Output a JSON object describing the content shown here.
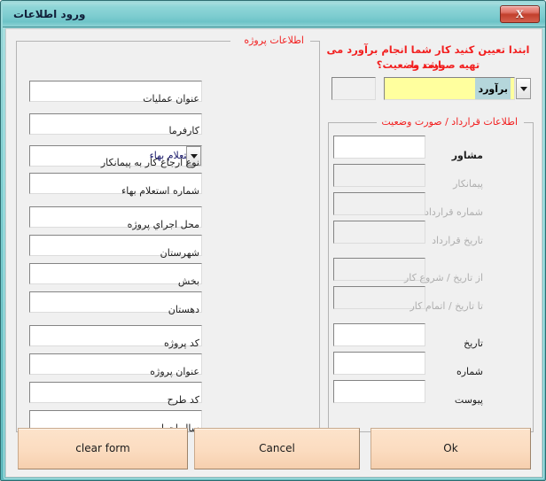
{
  "window": {
    "title": "ورود اطلاعات",
    "close_label": "X",
    "accent_titlebar": "#7ecdd0",
    "accent_border": "#2f6e72",
    "client_bg": "#f0f0f0"
  },
  "left_panel": {
    "legend": "اطلاعات پروژه",
    "legend_color": "#f22020",
    "rows": [
      {
        "label": "عنوان عملیات",
        "value": "",
        "type": "text",
        "enabled": true
      },
      {
        "label": "کارفرما",
        "value": "",
        "type": "text",
        "enabled": true
      },
      {
        "label": "نوع ارجاع کار به پیمانکار",
        "value": "استعلام بهاء",
        "type": "combo",
        "enabled": true
      },
      {
        "label": "شماره استعلام بهاء",
        "value": "",
        "type": "text",
        "enabled": true
      },
      {
        "label": "محل اجراي پروژه",
        "value": "",
        "type": "text",
        "enabled": true
      },
      {
        "label": "شهرستان",
        "value": "",
        "type": "text",
        "enabled": true
      },
      {
        "label": "بخش",
        "value": "",
        "type": "text",
        "enabled": true
      },
      {
        "label": "دهستان",
        "value": "",
        "type": "text",
        "enabled": true
      },
      {
        "label": "کد پروژه",
        "value": "",
        "type": "text",
        "enabled": true
      },
      {
        "label": "عنوان پروژه",
        "value": "",
        "type": "text",
        "enabled": true
      },
      {
        "label": "کد طرح",
        "value": "",
        "type": "text",
        "enabled": true
      },
      {
        "label": "سال اجرا",
        "value": "",
        "type": "text",
        "enabled": true
      }
    ]
  },
  "right_panel": {
    "prompt_line1": "ابتدا تعیین کنید کار شما انجام برآورد می باشد یا",
    "prompt_line2": "تهیه صورت وضعیت؟",
    "prompt_color": "#f22020",
    "mode_code_value": "",
    "mode_select": {
      "value": "برآورد",
      "selected_highlight": true,
      "bg": "#ffff9e"
    },
    "legend": "اطلاعات قرارداد / صورت وضعیت",
    "legend_color": "#f22020",
    "rows": [
      {
        "label": "مشاور",
        "value": "",
        "enabled": true
      },
      {
        "label": "پیمانکار",
        "value": "",
        "enabled": false
      },
      {
        "label": "شماره قرارداد",
        "value": "",
        "enabled": false
      },
      {
        "label": "تاریخ قرارداد",
        "value": "",
        "enabled": false
      },
      {
        "label": "از تاریخ / شروع کار",
        "value": "",
        "enabled": false
      },
      {
        "label": "تا تاریخ / اتمام کار",
        "value": "",
        "enabled": false
      },
      {
        "label": "تاریخ",
        "value": "",
        "enabled": true
      },
      {
        "label": "شماره",
        "value": "",
        "enabled": true
      },
      {
        "label": "پیوست",
        "value": "",
        "enabled": true
      }
    ]
  },
  "buttons": [
    {
      "name": "clear-form-button",
      "label": "clear form"
    },
    {
      "name": "cancel-button",
      "label": "Cancel"
    },
    {
      "name": "ok-button",
      "label": "Ok"
    }
  ],
  "button_color": "#fbdcc0"
}
